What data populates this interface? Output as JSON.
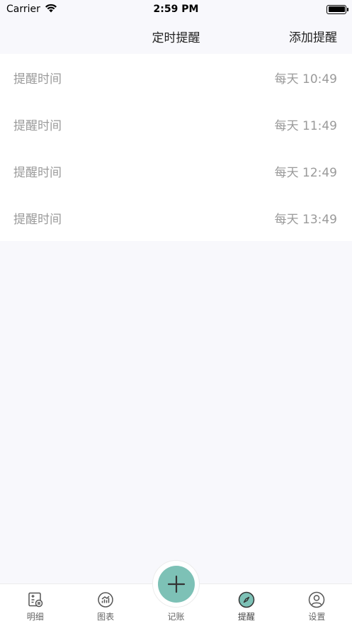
{
  "status_bar": {
    "carrier": "Carrier",
    "time": "2:59 PM"
  },
  "nav": {
    "title": "定时提醒",
    "action_label": "添加提醒"
  },
  "reminders": [
    {
      "label": "提醒时间",
      "value": "每天 10:49"
    },
    {
      "label": "提醒时间",
      "value": "每天 11:49"
    },
    {
      "label": "提醒时间",
      "value": "每天 12:49"
    },
    {
      "label": "提醒时间",
      "value": "每天 13:49"
    }
  ],
  "tabs": [
    {
      "label": "明细",
      "icon": "list-detail-icon"
    },
    {
      "label": "图表",
      "icon": "chart-icon"
    },
    {
      "label": "记账",
      "icon": "plus-icon"
    },
    {
      "label": "提醒",
      "icon": "compass-icon"
    },
    {
      "label": "设置",
      "icon": "user-circle-icon"
    }
  ],
  "colors": {
    "accent": "#7dc1b6",
    "background": "#f8f8fc",
    "muted_text": "#9a9a9a"
  }
}
